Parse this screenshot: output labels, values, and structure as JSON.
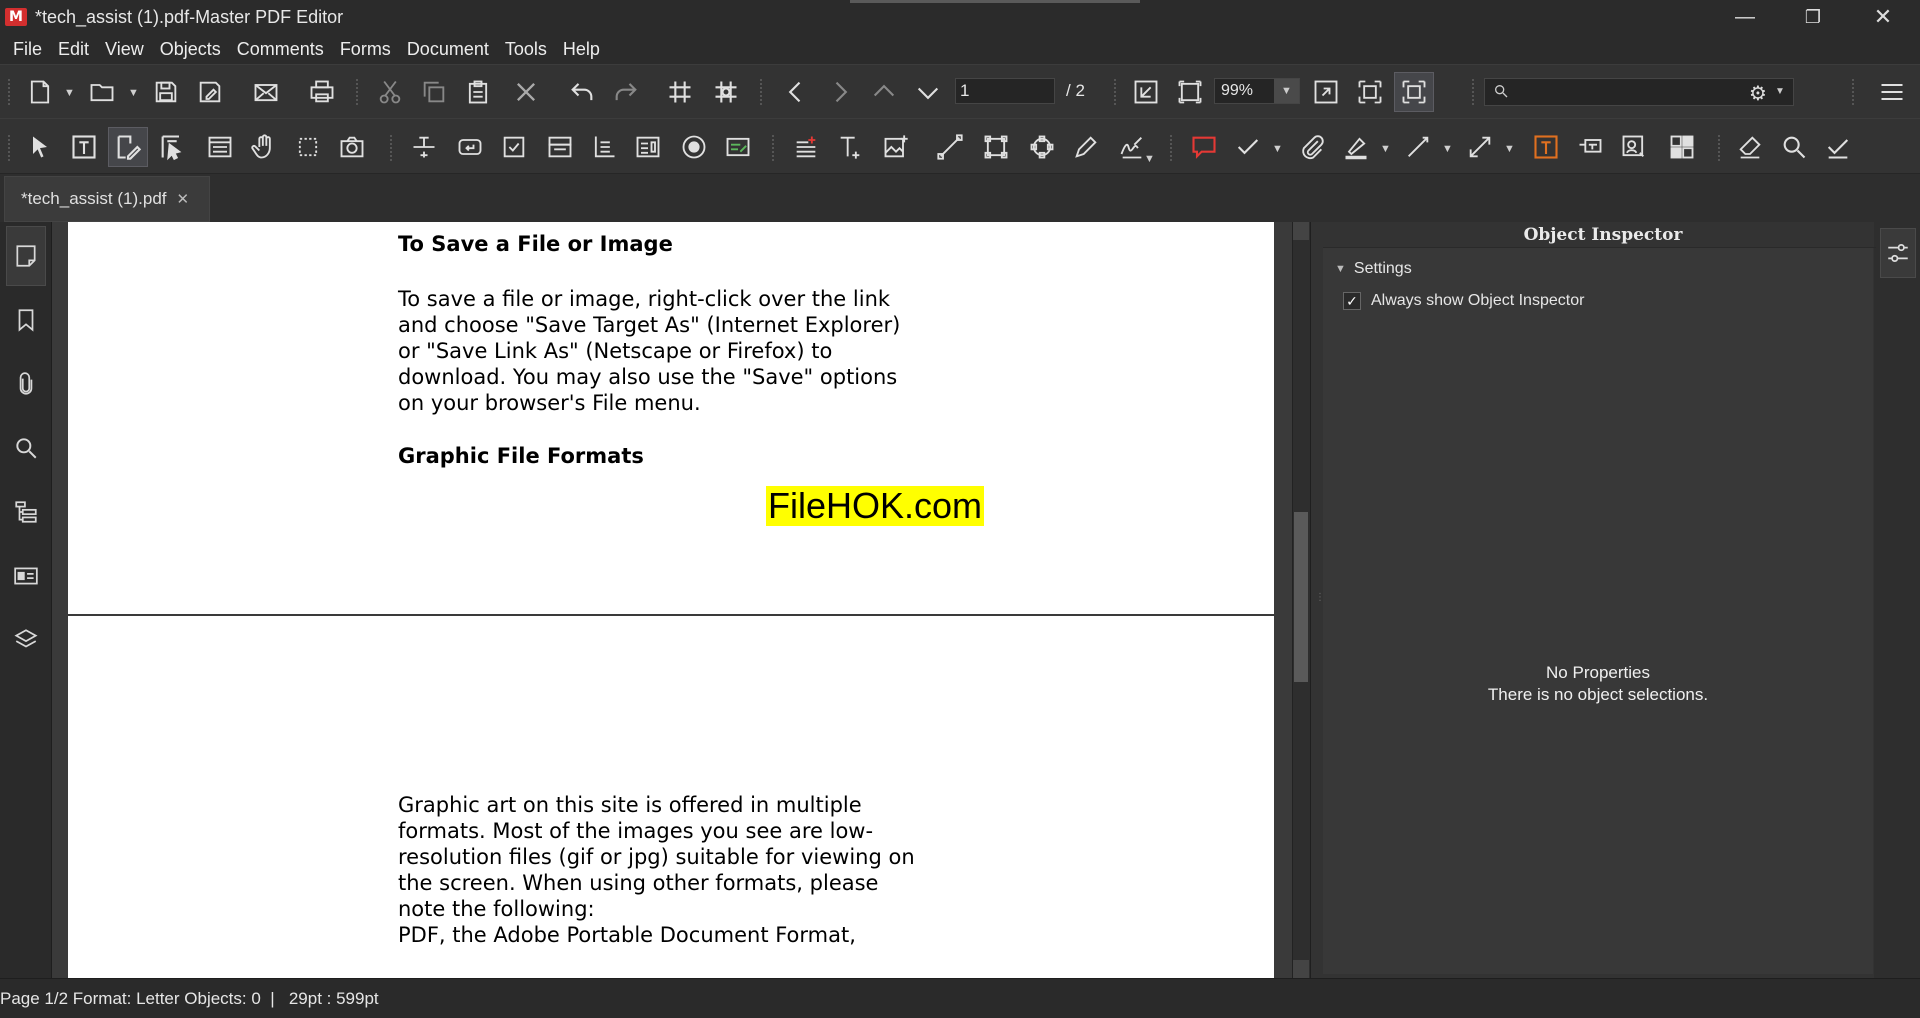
{
  "window": {
    "title": "*tech_assist (1).pdf-Master PDF Editor",
    "logo_text": "M",
    "minimize": "—",
    "restore": "❐",
    "close": "✕"
  },
  "menu": [
    "File",
    "Edit",
    "View",
    "Objects",
    "Comments",
    "Forms",
    "Document",
    "Tools",
    "Help"
  ],
  "navigation": {
    "page_value": "1",
    "page_total": "/ 2",
    "zoom": "99%"
  },
  "search": {
    "placeholder": ""
  },
  "tab": {
    "label": "*tech_assist (1).pdf",
    "close": "✕"
  },
  "document": {
    "heading1": "To Save a File or Image",
    "para1": "To save a file or image, right-click over the link\nand choose \"Save Target As\" (Internet Explorer)\nor \"Save Link As\" (Netscape or Firefox) to\ndownload. You may also use the \"Save\" options\non your browser's File menu.",
    "heading2": "Graphic File Formats",
    "watermark": "FileHOK.com",
    "para2": "Graphic art on this site is offered in multiple\nformats. Most of the images you see are low-\nresolution files (gif or jpg) suitable for viewing on\nthe screen. When using other formats, please\nnote the following:",
    "para3": "PDF, the Adobe Portable Document Format,"
  },
  "inspector": {
    "title": "Object Inspector",
    "section": "Settings",
    "checkbox_label": "Always show Object Inspector",
    "checkbox_checked": true,
    "no_props_title": "No Properties",
    "no_props_desc": "There is no object selections."
  },
  "status": {
    "info": "Page 1/2 Format: Letter Objects: 0  |   29pt : 599pt"
  }
}
